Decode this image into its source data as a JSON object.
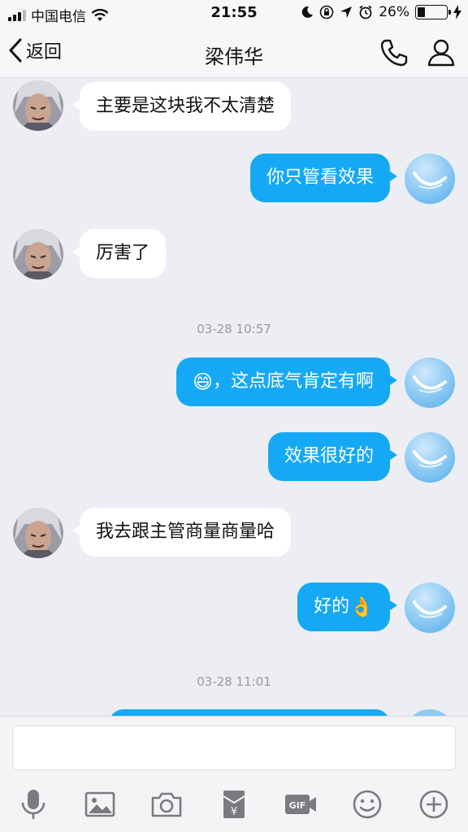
{
  "status_bar": {
    "carrier": "中国电信",
    "time": "21:55",
    "battery_percent": "26%",
    "battery_level": 0.26
  },
  "nav": {
    "back_label": "返回",
    "title": "梁伟华"
  },
  "messages": [
    {
      "side": "in",
      "text": "主要是这块我不太清楚"
    },
    {
      "side": "out",
      "text": "你只管看效果"
    },
    {
      "side": "in",
      "text": "厉害了"
    },
    {
      "timestamp": "03-28 10:57"
    },
    {
      "side": "out",
      "emoji": "😄",
      "text": "，这点底气肯定有啊"
    },
    {
      "side": "out",
      "text": "效果很好的"
    },
    {
      "side": "in",
      "text": "我去跟主管商量商量哈"
    },
    {
      "side": "out",
      "text": "好的",
      "emoji": "👌"
    },
    {
      "timestamp": "03-28 11:01"
    }
  ],
  "input": {
    "value": "",
    "placeholder": ""
  },
  "toolbar": {
    "icons": [
      "microphone-icon",
      "image-icon",
      "camera-icon",
      "red-packet-icon",
      "gif-icon",
      "emoji-icon",
      "plus-icon"
    ]
  },
  "colors": {
    "accent": "#15a9f5",
    "background": "#eceef3"
  }
}
